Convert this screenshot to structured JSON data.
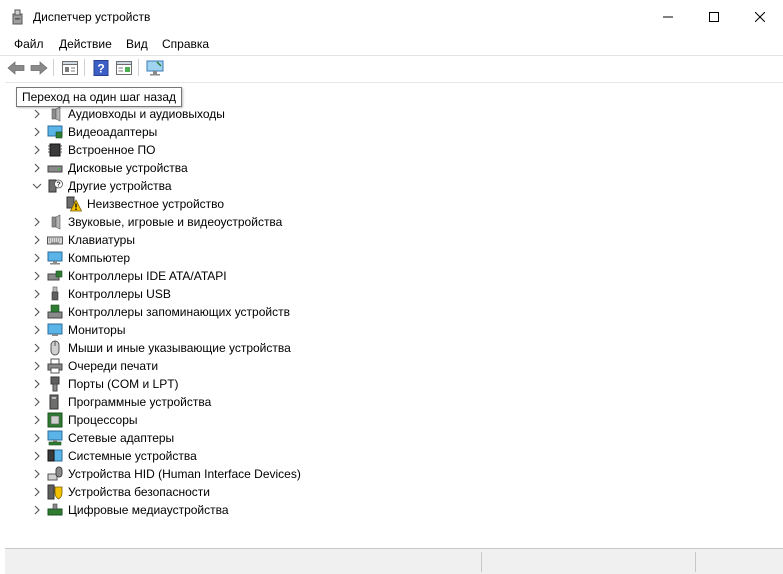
{
  "window": {
    "title": "Диспетчер устройств",
    "controls": [
      "minimize-icon",
      "maximize-icon",
      "close-icon"
    ]
  },
  "menu": [
    "Файл",
    "Действие",
    "Вид",
    "Справка"
  ],
  "toolbar": {
    "buttons": [
      "back-arrow-icon",
      "forward-arrow-icon",
      "properties-icon",
      "help-icon",
      "device-view-icon",
      "scan-hardware-icon"
    ]
  },
  "tooltip": "Переход на один шаг назад",
  "tree": {
    "items": [
      {
        "label": "Аудиовходы и аудиовыходы",
        "icon": "speaker-icon"
      },
      {
        "label": "Видеоадаптеры",
        "icon": "display-adapter-icon"
      },
      {
        "label": "Встроенное ПО",
        "icon": "firmware-icon"
      },
      {
        "label": "Дисковые устройства",
        "icon": "disk-drive-icon"
      },
      {
        "label": "Другие устройства",
        "icon": "unknown-device-icon",
        "expanded": true
      },
      {
        "label": "Неизвестное устройство",
        "icon": "warning-device-icon",
        "child": true
      },
      {
        "label": "Звуковые, игровые и видеоустройства",
        "icon": "speaker-icon"
      },
      {
        "label": "Клавиатуры",
        "icon": "keyboard-icon"
      },
      {
        "label": "Компьютер",
        "icon": "computer-icon"
      },
      {
        "label": "Контроллеры IDE ATA/ATAPI",
        "icon": "ide-controller-icon"
      },
      {
        "label": "Контроллеры USB",
        "icon": "usb-icon"
      },
      {
        "label": "Контроллеры запоминающих устройств",
        "icon": "storage-controller-icon"
      },
      {
        "label": "Мониторы",
        "icon": "monitor-icon"
      },
      {
        "label": "Мыши и иные указывающие устройства",
        "icon": "mouse-icon"
      },
      {
        "label": "Очереди печати",
        "icon": "printer-icon"
      },
      {
        "label": "Порты (COM и LPT)",
        "icon": "port-icon"
      },
      {
        "label": "Программные устройства",
        "icon": "software-device-icon"
      },
      {
        "label": "Процессоры",
        "icon": "processor-icon"
      },
      {
        "label": "Сетевые адаптеры",
        "icon": "network-adapter-icon"
      },
      {
        "label": "Системные устройства",
        "icon": "system-device-icon"
      },
      {
        "label": "Устройства HID (Human Interface Devices)",
        "icon": "hid-icon"
      },
      {
        "label": "Устройства безопасности",
        "icon": "security-device-icon"
      },
      {
        "label": "Цифровые медиаустройства",
        "icon": "media-device-icon"
      }
    ]
  },
  "colors": {
    "accent": "#3a96dd",
    "warning": "#f2c200",
    "chip": "#2e7d32"
  }
}
